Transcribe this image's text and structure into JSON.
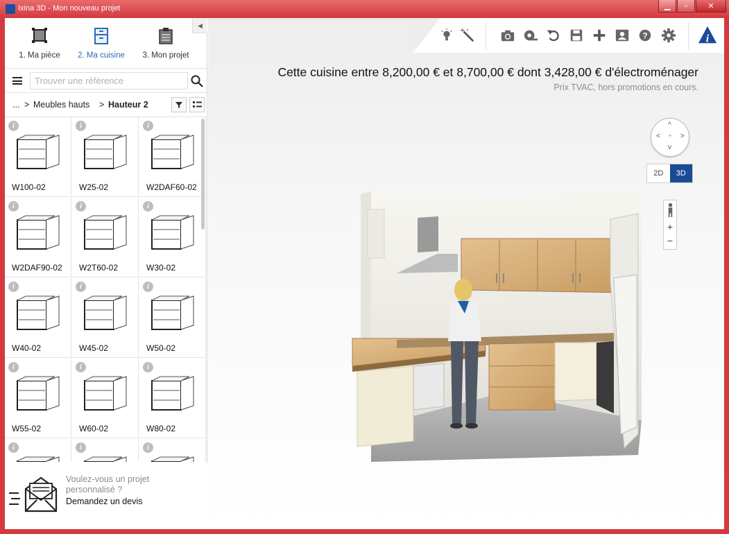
{
  "window": {
    "title": "Ixina 3D - Mon nouveau projet"
  },
  "steps": [
    {
      "label": "1. Ma pièce",
      "icon": "room-icon"
    },
    {
      "label": "2. Ma cuisine",
      "icon": "cabinet-icon"
    },
    {
      "label": "3. Mon projet",
      "icon": "clipboard-icon"
    }
  ],
  "search": {
    "placeholder": "Trouver une référence",
    "value": ""
  },
  "breadcrumb": {
    "ellipsis": "...",
    "sep": ">",
    "level1": "Meubles hauts",
    "level2": "Hauteur 2"
  },
  "catalog": {
    "items": [
      "W100-02",
      "W25-02",
      "W2DAF60-02",
      "W2DAF90-02",
      "W2T60-02",
      "W30-02",
      "W40-02",
      "W45-02",
      "W50-02",
      "W55-02",
      "W60-02",
      "W80-02",
      "",
      "",
      ""
    ]
  },
  "quote": {
    "line1": "Voulez-vous un projet",
    "line2": "personnalisé ?",
    "cta": "Demandez un devis"
  },
  "price": {
    "summary": "Cette cuisine entre 8,200,00 € et 8,700,00 € dont 3,428,00 € d'électroménager",
    "note": "Prix TVAC, hors promotions en cours."
  },
  "view": {
    "mode_2d": "2D",
    "mode_3d": "3D",
    "active": "3D",
    "zoom_in": "+",
    "zoom_out": "−"
  },
  "colors": {
    "accent": "#1b4b95",
    "step_active": "#2a6bb5",
    "frame": "#d23a3f"
  }
}
